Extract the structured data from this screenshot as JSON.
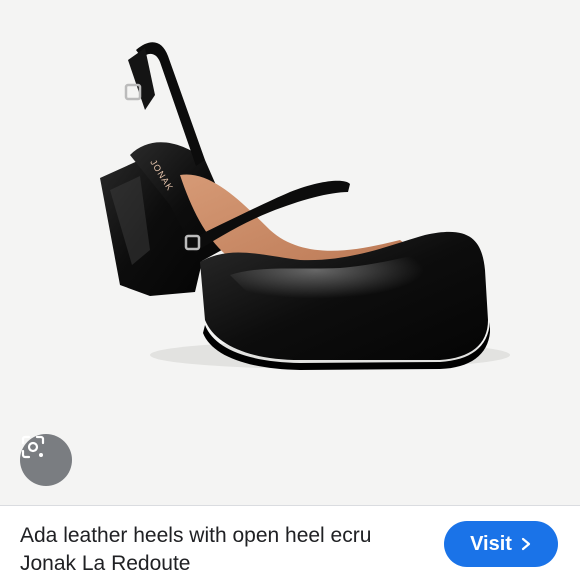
{
  "product": {
    "title": "Ada leather heels with open heel ecru Jonak La Redoute",
    "image_alt": "Black patent leather slingback heel with square toe and ankle strap",
    "brand_imprint": "JONAK"
  },
  "actions": {
    "visit_label": "Visit",
    "visit_icon": "chevron-right-icon",
    "lens_icon": "lens-search-icon"
  },
  "colors": {
    "visit_button": "#1a73e8",
    "image_background": "#f4f4f3",
    "shoe": "#111111",
    "lining": "#c98a66"
  }
}
